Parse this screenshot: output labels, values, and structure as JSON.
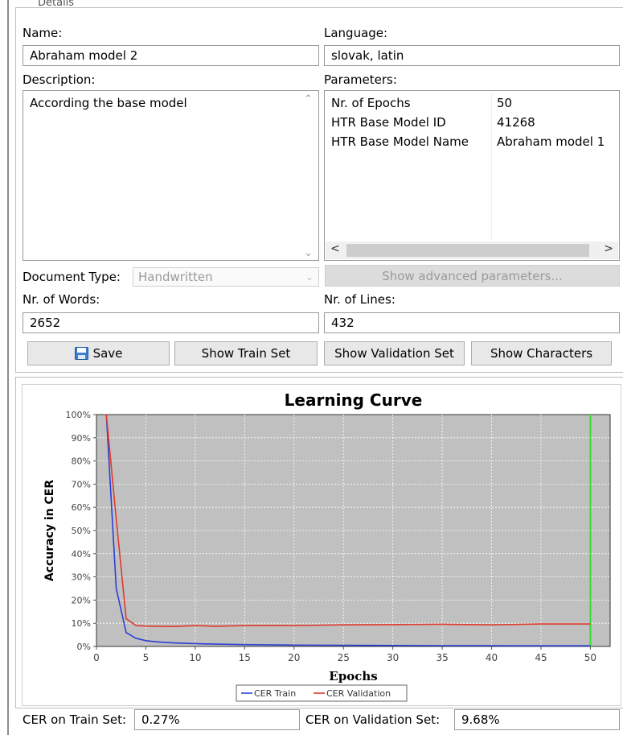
{
  "details": {
    "group_title": "Details",
    "name_label": "Name:",
    "name_value": "Abraham model 2",
    "language_label": "Language:",
    "language_value": "slovak, latin",
    "description_label": "Description:",
    "description_value": "According the base model",
    "parameters_label": "Parameters:",
    "parameters": [
      {
        "key": "Nr. of Epochs",
        "value": "50"
      },
      {
        "key": "HTR Base Model ID",
        "value": "41268"
      },
      {
        "key": "HTR Base Model Name",
        "value": "Abraham model 1"
      }
    ],
    "document_type_label": "Document Type:",
    "document_type_value": "Handwritten",
    "show_advanced_label": "Show advanced parameters...",
    "nr_words_label": "Nr. of Words:",
    "nr_words_value": "2652",
    "nr_lines_label": "Nr. of Lines:",
    "nr_lines_value": "432"
  },
  "buttons": {
    "save": "Save",
    "show_train_set": "Show Train Set",
    "show_validation_set": "Show Validation Set",
    "show_characters": "Show Characters"
  },
  "chart_data": {
    "type": "line",
    "title": "Learning Curve",
    "xlabel": "Epochs",
    "ylabel": "Accuracy in CER",
    "xlim": [
      0,
      52
    ],
    "ylim": [
      0,
      100
    ],
    "xticks": [
      0,
      5,
      10,
      15,
      20,
      25,
      30,
      35,
      40,
      45,
      50
    ],
    "yticks": [
      "0%",
      "10%",
      "20%",
      "30%",
      "40%",
      "50%",
      "60%",
      "70%",
      "80%",
      "90%",
      "100%"
    ],
    "grid": true,
    "legend_position": "bottom",
    "marker_line_x": 50,
    "colors": {
      "train": "#2b3fd4",
      "validation": "#e0392c",
      "marker": "#33dd33",
      "plot_bg": "#c0c0c0"
    },
    "series": [
      {
        "name": "CER Train",
        "x": [
          1,
          2,
          3,
          4,
          5,
          6,
          7,
          8,
          10,
          12,
          15,
          20,
          25,
          30,
          35,
          40,
          45,
          50
        ],
        "values": [
          100,
          25,
          6,
          3.5,
          2.5,
          2,
          1.7,
          1.5,
          1.2,
          1.0,
          0.8,
          0.6,
          0.5,
          0.4,
          0.35,
          0.3,
          0.28,
          0.27
        ]
      },
      {
        "name": "CER Validation",
        "x": [
          1,
          2,
          3,
          4,
          5,
          6,
          8,
          10,
          12,
          15,
          20,
          25,
          30,
          35,
          40,
          45,
          50
        ],
        "values": [
          100,
          55,
          12,
          9,
          8.8,
          8.7,
          8.6,
          9,
          8.7,
          9,
          9,
          9.3,
          9.4,
          9.6,
          9.3,
          9.7,
          9.68
        ]
      }
    ]
  },
  "footer": {
    "cer_train_label": "CER on Train Set:",
    "cer_train_value": "0.27%",
    "cer_validation_label": "CER on Validation Set:",
    "cer_validation_value": "9.68%"
  }
}
